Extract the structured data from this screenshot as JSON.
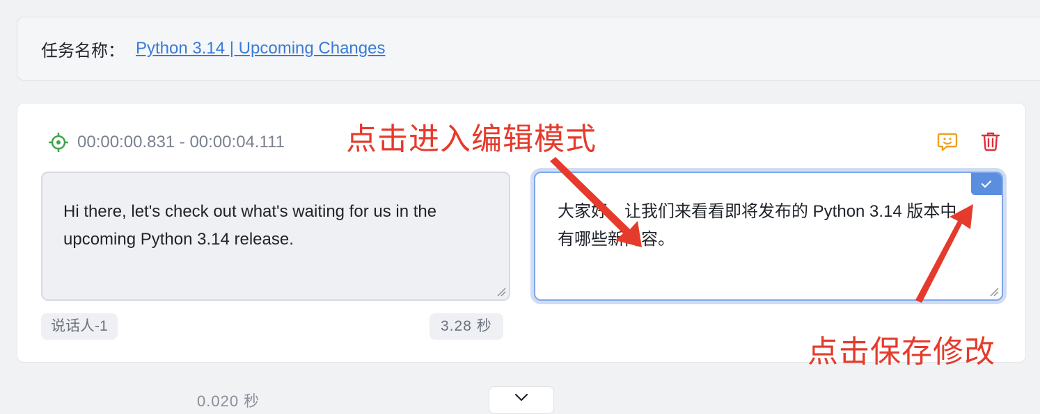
{
  "task": {
    "label": "任务名称：",
    "title": "Python 3.14 | Upcoming Changes"
  },
  "segment": {
    "timecode": "00:00:00.831 - 00:00:04.111",
    "source_text": " Hi there, let's check out what's waiting for us in the upcoming Python 3.14 release.",
    "translation_text": "大家好，让我们来看看即将发布的 Python 3.14 版本中有哪些新内容。",
    "speaker": "说话人-1",
    "duration": "3.28 秒"
  },
  "gap": {
    "duration": "0.020 秒"
  },
  "annotations": {
    "edit_mode": "点击进入编辑模式",
    "save": "点击保存修改",
    "color": "#e53b2c"
  },
  "colors": {
    "accent": "#5a8fe0",
    "link": "#3a7bd5",
    "target_icon": "#3fa34d",
    "comment_icon": "#f0a020",
    "delete_icon": "#e0303a"
  }
}
